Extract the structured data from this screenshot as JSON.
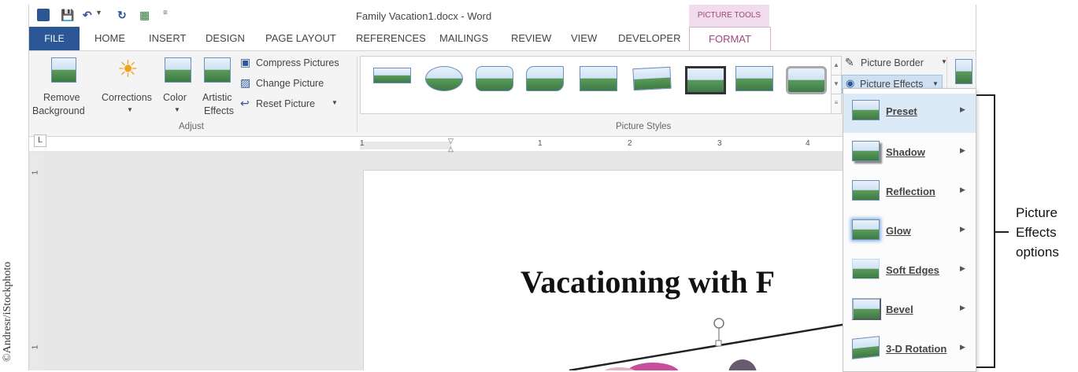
{
  "credit": "©Andresr/iStockphoto",
  "window": {
    "title": "Family Vacation1.docx - Word",
    "context_group": "PICTURE TOOLS"
  },
  "tabs": [
    "FILE",
    "HOME",
    "INSERT",
    "DESIGN",
    "PAGE LAYOUT",
    "REFERENCES",
    "MAILINGS",
    "REVIEW",
    "VIEW",
    "DEVELOPER",
    "FORMAT"
  ],
  "ribbon": {
    "remove_background": [
      "Remove",
      "Background"
    ],
    "corrections": "Corrections",
    "color": "Color",
    "artistic_effects": [
      "Artistic",
      "Effects"
    ],
    "compress": "Compress Pictures",
    "change": "Change Picture",
    "reset": "Reset Picture",
    "adjust_label": "Adjust",
    "picture_styles_label": "Picture Styles",
    "picture_border": "Picture Border",
    "picture_effects": "Picture Effects"
  },
  "ruler_numbers": [
    "1",
    "1",
    "2",
    "3",
    "4"
  ],
  "vruler_numbers": [
    "1",
    "1"
  ],
  "document": {
    "heading": "Vacationing with F"
  },
  "effects_menu": [
    {
      "label": "Preset"
    },
    {
      "label": "Shadow"
    },
    {
      "label": "Reflection"
    },
    {
      "label": "Glow"
    },
    {
      "label": "Soft Edges"
    },
    {
      "label": "Bevel"
    },
    {
      "label": "3-D Rotation"
    }
  ],
  "callout": {
    "line1": "Picture",
    "line2": "Effects",
    "line3": "options"
  },
  "colors": {
    "file_tab": "#2b5797",
    "context_tab": "#a0487c",
    "context_bg": "#f1dced"
  }
}
